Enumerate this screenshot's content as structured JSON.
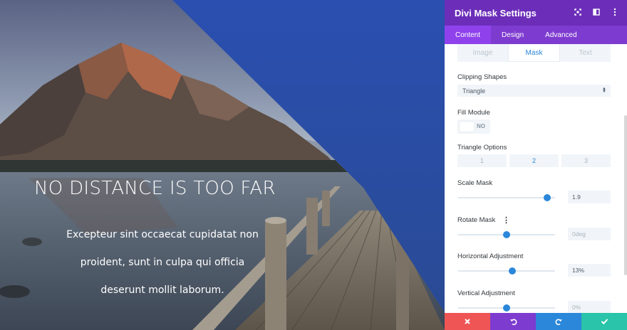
{
  "preview": {
    "title": "NO DISTANCE IS TOO FAR",
    "body_lines": [
      "Excepteur sint occaecat cupidatat non",
      "proident, sunt in culpa qui officia",
      "deserunt mollit laborum."
    ]
  },
  "panel": {
    "title": "Divi Mask Settings",
    "header_icons": [
      "expand-icon",
      "split-view-icon",
      "more-options-icon"
    ],
    "tabs": [
      {
        "label": "Content",
        "active": true
      },
      {
        "label": "Design",
        "active": false
      },
      {
        "label": "Advanced",
        "active": false
      }
    ],
    "subtabs": [
      {
        "label": "Image",
        "active": false
      },
      {
        "label": "Mask",
        "active": true
      },
      {
        "label": "Text",
        "active": false
      }
    ],
    "clipping_shapes": {
      "label": "Clipping Shapes",
      "value": "Triangle"
    },
    "fill_module": {
      "label": "Fill Module",
      "value": "NO"
    },
    "triangle_options": {
      "label": "Triangle Options",
      "options": [
        "1",
        "2",
        "3"
      ],
      "selected": "2"
    },
    "scale_mask": {
      "label": "Scale Mask",
      "value": "1.9",
      "level": 0.92
    },
    "rotate_mask": {
      "label": "Rotate Mask",
      "value": "0deg",
      "level": 0.5
    },
    "horizontal_adjustment": {
      "label": "Horizontal Adjustment",
      "value": "13%",
      "level": 0.56
    },
    "vertical_adjustment": {
      "label": "Vertical Adjustment",
      "value": "0%",
      "level": 0.5
    }
  },
  "footer": {
    "buttons": [
      "close-icon",
      "undo-icon",
      "redo-icon",
      "save-check-icon"
    ]
  },
  "colors": {
    "header": "#6c2eb9",
    "tab_bar": "#7e3bd0",
    "active_tab": "#8f42ec",
    "accent_blue": "#2b87da",
    "overlay_blue": "#2b56a8",
    "footer_close": "#ef5555",
    "footer_undo": "#7e3bd0",
    "footer_redo": "#2b87da",
    "footer_save": "#29c4a9"
  }
}
